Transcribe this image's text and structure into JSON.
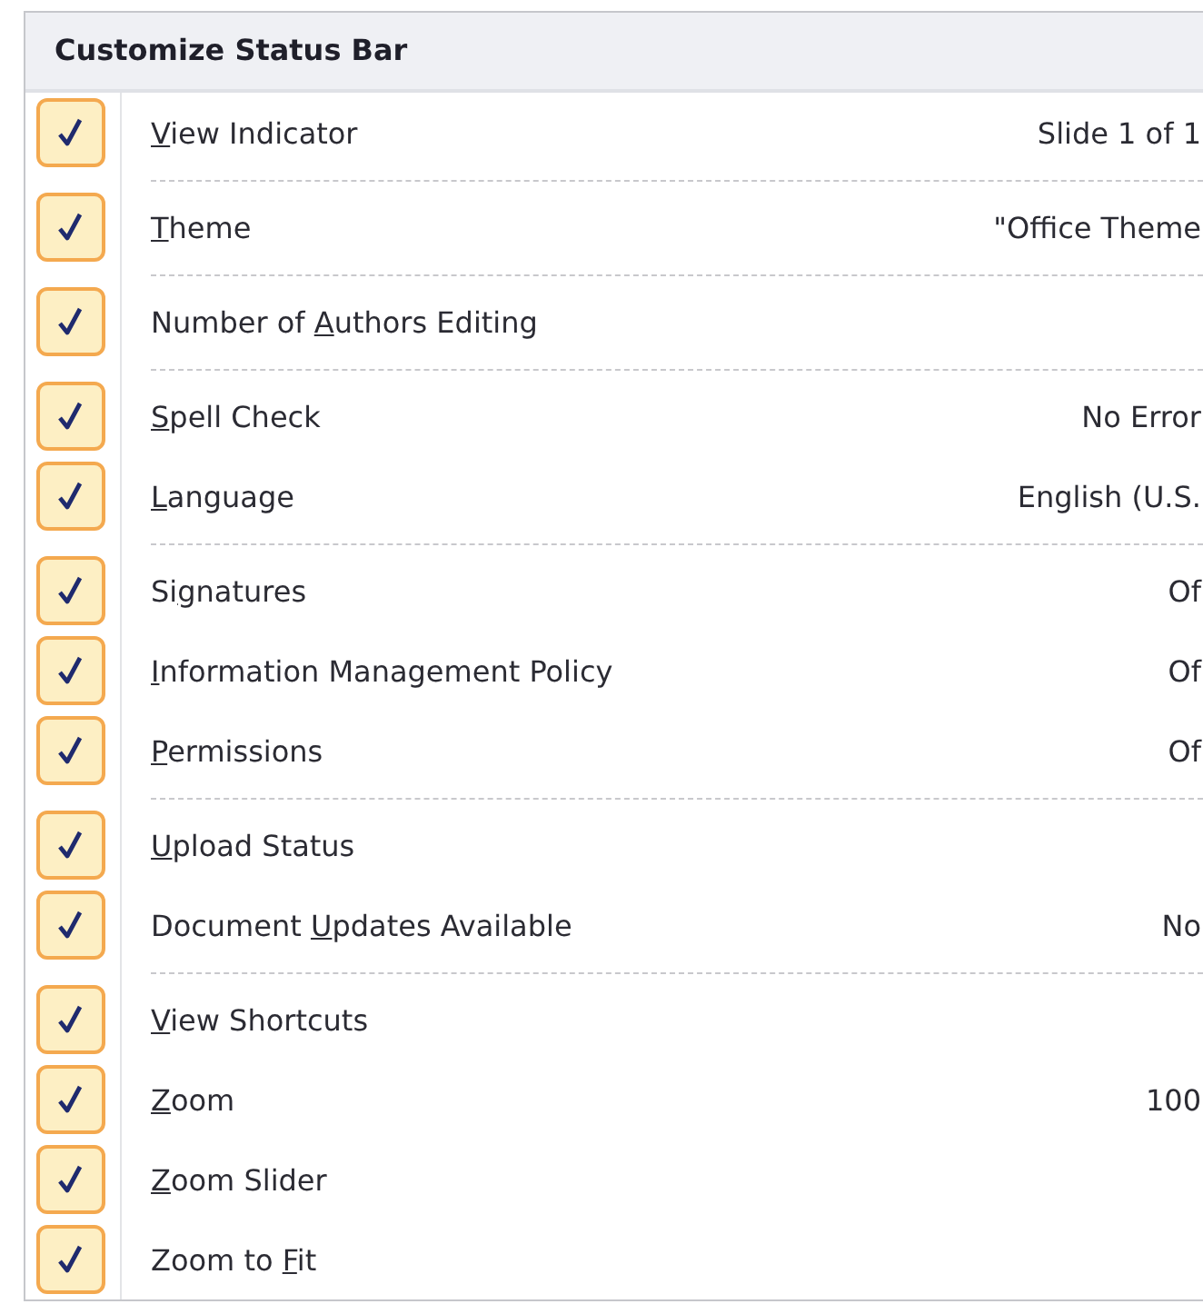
{
  "menu": {
    "title": "Customize Status Bar",
    "groups": [
      {
        "items": [
          {
            "label": {
              "key": "V",
              "after": "iew Indicator"
            },
            "value": "Slide 1 of 1",
            "checked": true
          }
        ]
      },
      {
        "items": [
          {
            "label": {
              "key": "T",
              "after": "heme"
            },
            "value": "\"Office Theme",
            "checked": true
          }
        ]
      },
      {
        "items": [
          {
            "label": {
              "before": "Number of ",
              "key": "A",
              "after": "uthors Editing"
            },
            "checked": true
          }
        ]
      },
      {
        "items": [
          {
            "label": {
              "key": "S",
              "after": "pell Check"
            },
            "value": "No Error",
            "checked": true
          },
          {
            "label": {
              "key": "L",
              "after": "anguage"
            },
            "value": "English (U.S.",
            "checked": true
          }
        ]
      },
      {
        "items": [
          {
            "label": {
              "before": "Si",
              "key": "g",
              "after": "natures"
            },
            "value": "Of",
            "checked": true
          },
          {
            "label": {
              "key": "I",
              "after": "nformation Management Policy"
            },
            "value": "Of",
            "checked": true
          },
          {
            "label": {
              "key": "P",
              "after": "ermissions"
            },
            "value": "Of",
            "checked": true
          }
        ]
      },
      {
        "items": [
          {
            "label": {
              "key": "U",
              "after": "pload Status"
            },
            "checked": true
          },
          {
            "label": {
              "before": "Document ",
              "key": "U",
              "after": "pdates Available"
            },
            "value": "No",
            "checked": true
          }
        ]
      },
      {
        "items": [
          {
            "label": {
              "key": "V",
              "after": "iew Shortcuts"
            },
            "checked": true
          },
          {
            "label": {
              "key": "Z",
              "after": "oom"
            },
            "value": "100",
            "checked": true
          },
          {
            "label": {
              "key": "Z",
              "after": "oom Slider"
            },
            "checked": true
          },
          {
            "label": {
              "before": "Zoom to ",
              "key": "F",
              "after": "it"
            },
            "checked": true
          }
        ]
      }
    ]
  }
}
